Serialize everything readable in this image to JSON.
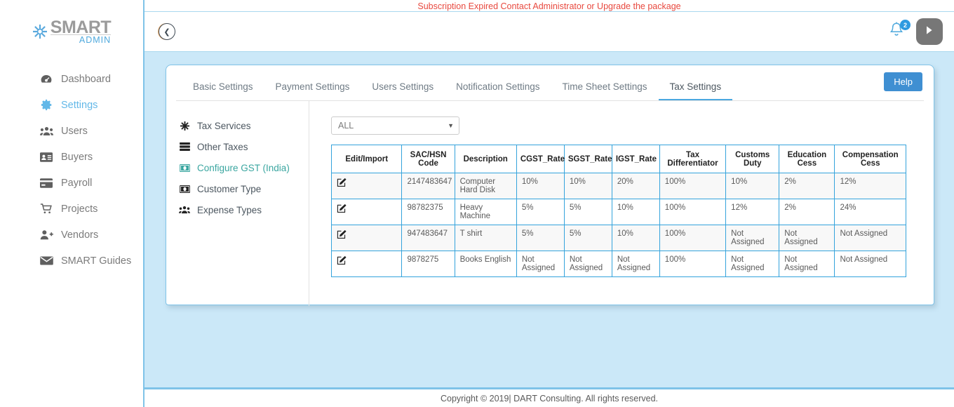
{
  "brand": {
    "name": "SMART",
    "sub": "ADMIN",
    "logo_icon": "asterisk-logo-icon"
  },
  "sidebar": {
    "items": [
      {
        "label": "Dashboard",
        "icon": "dashboard-icon",
        "active": false
      },
      {
        "label": "Settings",
        "icon": "gear-icon",
        "active": true
      },
      {
        "label": "Users",
        "icon": "users-icon",
        "active": false
      },
      {
        "label": "Buyers",
        "icon": "id-card-icon",
        "active": false
      },
      {
        "label": "Payroll",
        "icon": "credit-card-icon",
        "active": false
      },
      {
        "label": "Projects",
        "icon": "cart-icon",
        "active": false
      },
      {
        "label": "Vendors",
        "icon": "user-plus-icon",
        "active": false
      },
      {
        "label": "SMART Guides",
        "icon": "envelope-icon",
        "active": false
      }
    ]
  },
  "topbar": {
    "alert": "Subscription Expired Contact Administrator or Upgrade the package",
    "collapse_icon": "chevron-left-icon",
    "bell_icon": "bell-icon",
    "notification_count": "2",
    "user_icon": "arrow-right-icon"
  },
  "card": {
    "tabs": [
      {
        "label": "Basic Settings",
        "active": false
      },
      {
        "label": "Payment Settings",
        "active": false
      },
      {
        "label": "Users Settings",
        "active": false
      },
      {
        "label": "Notification Settings",
        "active": false
      },
      {
        "label": "Time Sheet Settings",
        "active": false
      },
      {
        "label": "Tax Settings",
        "active": true
      }
    ],
    "help_label": "Help",
    "submenu": [
      {
        "label": "Tax Services",
        "icon": "asterisk-icon",
        "active": false
      },
      {
        "label": "Other Taxes",
        "icon": "server-icon",
        "active": false
      },
      {
        "label": "Configure GST (India)",
        "icon": "money-bill-icon",
        "active": true
      },
      {
        "label": "Customer Type",
        "icon": "money-bill-icon",
        "active": false
      },
      {
        "label": "Expense Types",
        "icon": "users-icon",
        "active": false
      }
    ],
    "filter": {
      "value": "ALL",
      "caret_icon": "chevron-down-icon"
    }
  },
  "table": {
    "columns": [
      "Edit/Import",
      "SAC/HSN Code",
      "Description",
      "CGST_Rate",
      "SGST_Rate",
      "IGST_Rate",
      "Tax Differentiator",
      "Customs Duty",
      "Education Cess",
      "Compensation Cess"
    ],
    "edit_icon": "edit-pencil-icon",
    "rows": [
      {
        "sac": "2147483647",
        "description": "Computer Hard Disk",
        "cgst": "10%",
        "sgst": "10%",
        "igst": "20%",
        "tax_diff": "100%",
        "customs": "10%",
        "education": "2%",
        "compensation": "12%"
      },
      {
        "sac": "98782375",
        "description": "Heavy Machine",
        "cgst": "5%",
        "sgst": "5%",
        "igst": "10%",
        "tax_diff": "100%",
        "customs": "12%",
        "education": "2%",
        "compensation": "24%"
      },
      {
        "sac": "947483647",
        "description": "T shirt",
        "cgst": "5%",
        "sgst": "5%",
        "igst": "10%",
        "tax_diff": "100%",
        "customs": "Not Assigned",
        "education": "Not Assigned",
        "compensation": "Not Assigned"
      },
      {
        "sac": "9878275",
        "description": "Books English",
        "cgst": "Not Assigned",
        "sgst": "Not Assigned",
        "igst": "Not Assigned",
        "tax_diff": "100%",
        "customs": "Not Assigned",
        "education": "Not Assigned",
        "compensation": "Not Assigned"
      }
    ]
  },
  "footer": {
    "text": "Copyright © 2019| DART Consulting. All rights reserved."
  },
  "colors": {
    "accent_blue": "#4aa8e0",
    "page_bg": "#cbe8f8",
    "alert_red": "#e8493f",
    "table_border": "#34a3dc",
    "active_submenu": "#3aa6a0"
  }
}
